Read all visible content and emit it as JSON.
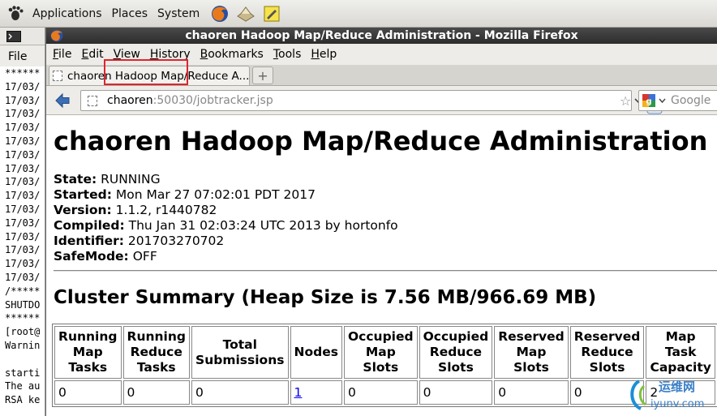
{
  "panel": {
    "menus": [
      "Applications",
      "Places",
      "System"
    ]
  },
  "terminal": {
    "menu_file": "File",
    "lines": [
      "******",
      "17/03/",
      "17/03/",
      "17/03/",
      "17/03/",
      "17/03/",
      "17/03/",
      "17/03/",
      "17/03/",
      "17/03/",
      "17/03/",
      "17/03/",
      "17/03/",
      "17/03/",
      "17/03/",
      "17/03/",
      "/*****",
      "SHUTDO",
      "******",
      "[root@",
      "Warnin",
      "",
      "starti",
      "The au",
      "RSA ke"
    ]
  },
  "firefox": {
    "window_title": "chaoren Hadoop Map/Reduce Administration - Mozilla Firefox",
    "menus": [
      "File",
      "Edit",
      "View",
      "History",
      "Bookmarks",
      "Tools",
      "Help"
    ],
    "tab_title": "chaoren Hadoop Map/Reduce A...",
    "new_tab": "+",
    "url_host": "chaoren",
    "url_rest": ":50030/jobtracker.jsp",
    "search_placeholder": "Google"
  },
  "page": {
    "title": "chaoren Hadoop Map/Reduce Administration",
    "info": [
      {
        "label": "State:",
        "value": "RUNNING"
      },
      {
        "label": "Started:",
        "value": "Mon Mar 27 07:02:01 PDT 2017"
      },
      {
        "label": "Version:",
        "value": "1.1.2, r1440782"
      },
      {
        "label": "Compiled:",
        "value": "Thu Jan 31 02:03:24 UTC 2013 by hortonfo"
      },
      {
        "label": "Identifier:",
        "value": "201703270702"
      },
      {
        "label": "SafeMode:",
        "value": "OFF"
      }
    ],
    "cluster_title": "Cluster Summary (Heap Size is 7.56 MB/966.69 MB)",
    "table": {
      "headers": [
        "Running Map Tasks",
        "Running Reduce Tasks",
        "Total Submissions",
        "Nodes",
        "Occupied Map Slots",
        "Occupied Reduce Slots",
        "Reserved Map Slots",
        "Reserved Reduce Slots",
        "Map Task Capacity"
      ],
      "row": [
        "0",
        "0",
        "0",
        "1",
        "0",
        "0",
        "0",
        "0",
        "2"
      ]
    }
  },
  "watermark": {
    "text_cn": "运维网",
    "text_url": "iyunv.com"
  },
  "colors": {
    "highlight_box": "#e0242c",
    "link": "#0000ee"
  }
}
